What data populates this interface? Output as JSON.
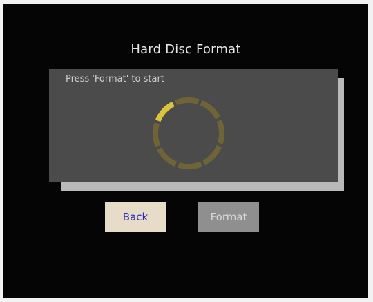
{
  "screen": {
    "title": "Hard Disc Format",
    "prompt": "Press 'Format' to start"
  },
  "progress": {
    "fraction": 0.125,
    "active_color": "#d9c43a",
    "inactive_color": "#6e6436"
  },
  "buttons": {
    "back_label": "Back",
    "format_label": "Format"
  }
}
